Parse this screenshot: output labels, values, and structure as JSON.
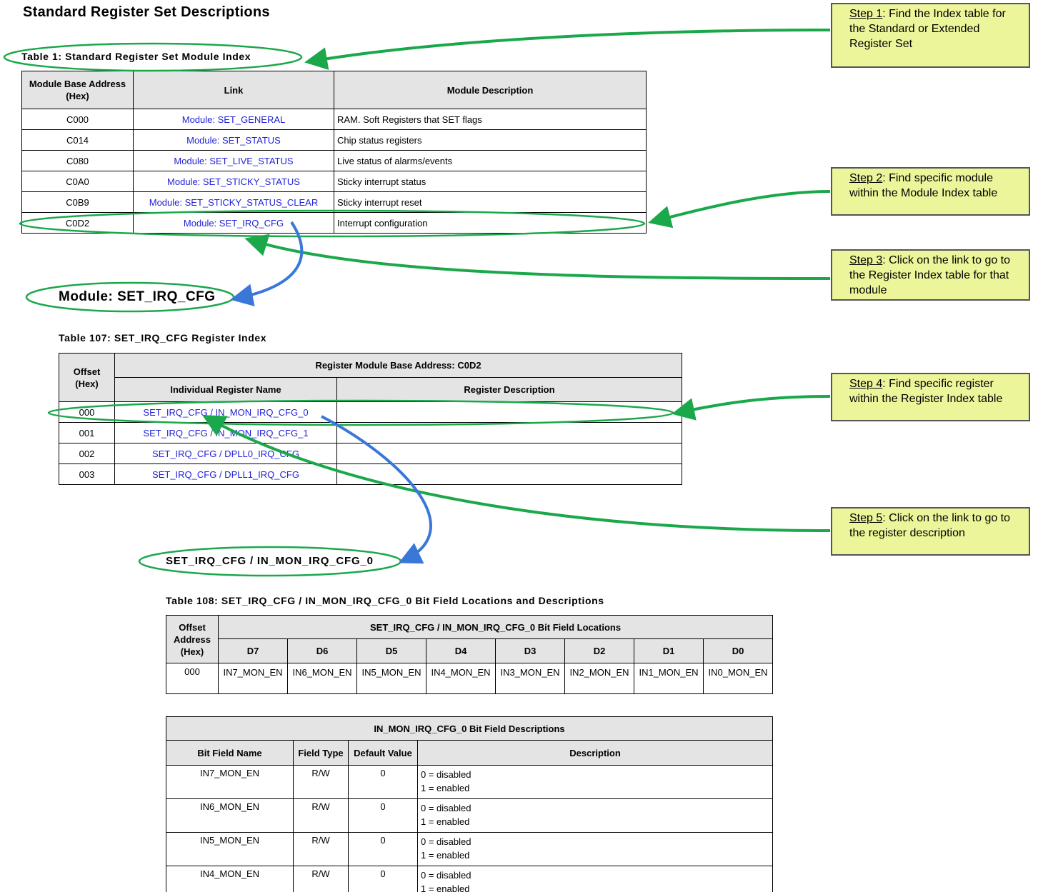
{
  "page_title": "Standard Register Set Descriptions",
  "table1": {
    "caption": "Table 1: Standard Register Set Module Index",
    "headers": [
      "Module Base Address (Hex)",
      "Link",
      "Module Description"
    ],
    "rows": [
      {
        "addr": "C000",
        "link": "Module: SET_GENERAL",
        "desc": "RAM. Soft Registers that SET flags"
      },
      {
        "addr": "C014",
        "link": "Module: SET_STATUS",
        "desc": "Chip status registers"
      },
      {
        "addr": "C080",
        "link": "Module: SET_LIVE_STATUS",
        "desc": "Live status of alarms/events"
      },
      {
        "addr": "C0A0",
        "link": "Module: SET_STICKY_STATUS",
        "desc": "Sticky interrupt status"
      },
      {
        "addr": "C0B9",
        "link": "Module: SET_STICKY_STATUS_CLEAR",
        "desc": "Sticky interrupt reset"
      },
      {
        "addr": "C0D2",
        "link": "Module: SET_IRQ_CFG",
        "desc": "Interrupt configuration"
      }
    ]
  },
  "module_heading": "Module: SET_IRQ_CFG",
  "table107": {
    "caption": "Table 107: SET_IRQ_CFG Register Index",
    "offset_header": "Offset (Hex)",
    "group_header": "Register Module Base Address: C0D2",
    "name_header": "Individual Register Name",
    "desc_header": "Register Description",
    "rows": [
      {
        "offset": "000",
        "name": "SET_IRQ_CFG / IN_MON_IRQ_CFG_0",
        "desc": ""
      },
      {
        "offset": "001",
        "name": "SET_IRQ_CFG / IN_MON_IRQ_CFG_1",
        "desc": ""
      },
      {
        "offset": "002",
        "name": "SET_IRQ_CFG / DPLL0_IRQ_CFG",
        "desc": ""
      },
      {
        "offset": "003",
        "name": "SET_IRQ_CFG / DPLL1_IRQ_CFG",
        "desc": ""
      }
    ]
  },
  "register_heading": "SET_IRQ_CFG / IN_MON_IRQ_CFG_0",
  "table108": {
    "caption": "Table 108: SET_IRQ_CFG / IN_MON_IRQ_CFG_0 Bit Field Locations and Descriptions",
    "offset_header": "Offset Address (Hex)",
    "group_header": "SET_IRQ_CFG / IN_MON_IRQ_CFG_0 Bit Field Locations",
    "bits": [
      "D7",
      "D6",
      "D5",
      "D4",
      "D3",
      "D2",
      "D1",
      "D0"
    ],
    "offset": "000",
    "fields": [
      "IN7_MON_EN",
      "IN6_MON_EN",
      "IN5_MON_EN",
      "IN4_MON_EN",
      "IN3_MON_EN",
      "IN2_MON_EN",
      "IN1_MON_EN",
      "IN0_MON_EN"
    ]
  },
  "desc_table": {
    "title": "IN_MON_IRQ_CFG_0 Bit Field Descriptions",
    "headers": [
      "Bit Field Name",
      "Field Type",
      "Default Value",
      "Description"
    ],
    "rows": [
      {
        "name": "IN7_MON_EN",
        "type": "R/W",
        "default": "0",
        "line1": "0 = disabled",
        "line2": "1 = enabled"
      },
      {
        "name": "IN6_MON_EN",
        "type": "R/W",
        "default": "0",
        "line1": "0 = disabled",
        "line2": "1 = enabled"
      },
      {
        "name": "IN5_MON_EN",
        "type": "R/W",
        "default": "0",
        "line1": "0 = disabled",
        "line2": "1 = enabled"
      },
      {
        "name": "IN4_MON_EN",
        "type": "R/W",
        "default": "0",
        "line1": "0 = disabled",
        "line2": "1 = enabled"
      }
    ]
  },
  "steps": [
    {
      "label": "Step 1",
      "text": ": Find the Index table for the Standard or Extended Register Set"
    },
    {
      "label": "Step 2",
      "text": ": Find specific module within the Module Index table"
    },
    {
      "label": "Step 3",
      "text": ": Click on the link to go to the Register Index table for that module"
    },
    {
      "label": "Step 4",
      "text": ": Find specific register within the Register Index table"
    },
    {
      "label": "Step 5",
      "text": ": Click on the link to go to the register description"
    }
  ],
  "colors": {
    "annotation_green": "#1aa84a",
    "annotation_blue": "#3a78d8",
    "note_fill": "#ecf59a",
    "link_blue": "#1f1fd8",
    "header_gray": "#e4e4e4"
  }
}
